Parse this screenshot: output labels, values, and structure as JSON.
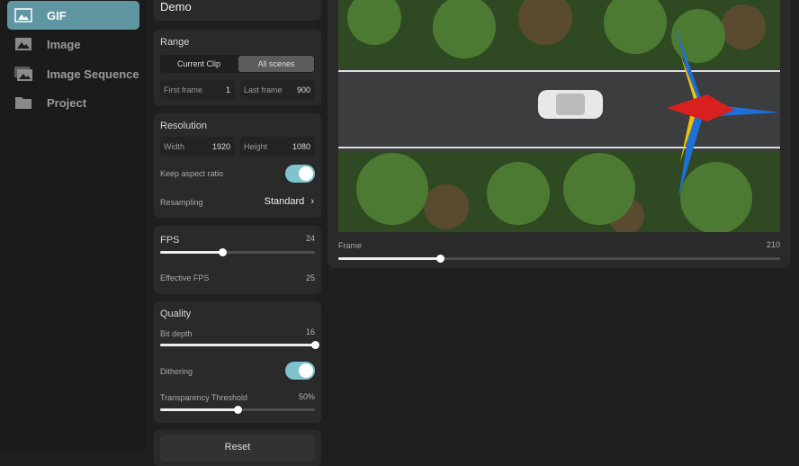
{
  "sidebar": {
    "items": [
      {
        "label": "GIF",
        "icon": "gif-icon",
        "active": true
      },
      {
        "label": "Image",
        "icon": "image-icon"
      },
      {
        "label": "Image Sequence",
        "icon": "image-sequence-icon"
      },
      {
        "label": "Project",
        "icon": "folder-icon"
      }
    ]
  },
  "preset": {
    "name": "Demo"
  },
  "range": {
    "title": "Range",
    "tabs": [
      "Current Clip",
      "All scenes"
    ],
    "selected": "All scenes",
    "first_label": "First frame",
    "first_value": "1",
    "last_label": "Last frame",
    "last_value": "900"
  },
  "resolution": {
    "title": "Resolution",
    "width_label": "Width",
    "width_value": "1920",
    "height_label": "Height",
    "height_value": "1080",
    "aspect_label": "Keep aspect ratio",
    "aspect_on": true,
    "resampling_label": "Resampling",
    "resampling_value": "Standard"
  },
  "fps": {
    "title": "FPS",
    "value": "24",
    "slider_fraction": 0.4,
    "effective_label": "Effective FPS",
    "effective_value": "25"
  },
  "quality": {
    "title": "Quality",
    "bitdepth_label": "Bit depth",
    "bitdepth_value": "16",
    "bitdepth_fraction": 1.0,
    "dithering_label": "Dithering",
    "dithering_on": true,
    "transparency_label": "Transparency Threshold",
    "transparency_value": "50%",
    "transparency_fraction": 0.5
  },
  "reset_label": "Reset",
  "preview": {
    "frame_label": "Frame",
    "frame_value": "210",
    "frame_fraction": 0.23
  },
  "colors": {
    "accent": "#5f96a1",
    "toggle": "#7fc3cf"
  }
}
